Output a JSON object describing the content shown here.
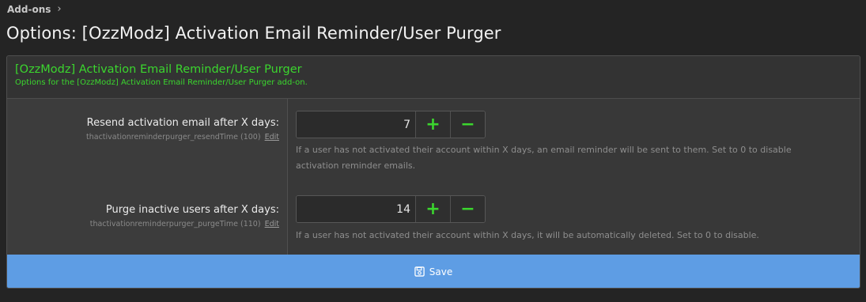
{
  "breadcrumb": {
    "item": "Add-ons",
    "separator": "›"
  },
  "page": {
    "title": "Options: [OzzModz] Activation Email Reminder/User Purger"
  },
  "block": {
    "title": "[OzzModz] Activation Email Reminder/User Purger",
    "description": "Options for the [OzzModz] Activation Email Reminder/User Purger add-on."
  },
  "options": [
    {
      "label": "Resend activation email after X days:",
      "id_text": "thactivationreminderpurger_resendTime (100)",
      "edit_label": "Edit",
      "value": "7",
      "plus": "+",
      "minus": "−",
      "hint": "If a user has not activated their account within X days, an email reminder will be sent to them. Set to 0 to disable activation reminder emails."
    },
    {
      "label": "Purge inactive users after X days:",
      "id_text": "thactivationreminderpurger_purgeTime (110)",
      "edit_label": "Edit",
      "value": "14",
      "plus": "+",
      "minus": "−",
      "hint": "If a user has not activated their account within X days, it will be automatically deleted. Set to 0 to disable."
    }
  ],
  "submit": {
    "save_label": "Save",
    "icon": "save-icon"
  },
  "colors": {
    "accent_green": "#3bd62e",
    "save_bar": "#5e9de4"
  }
}
